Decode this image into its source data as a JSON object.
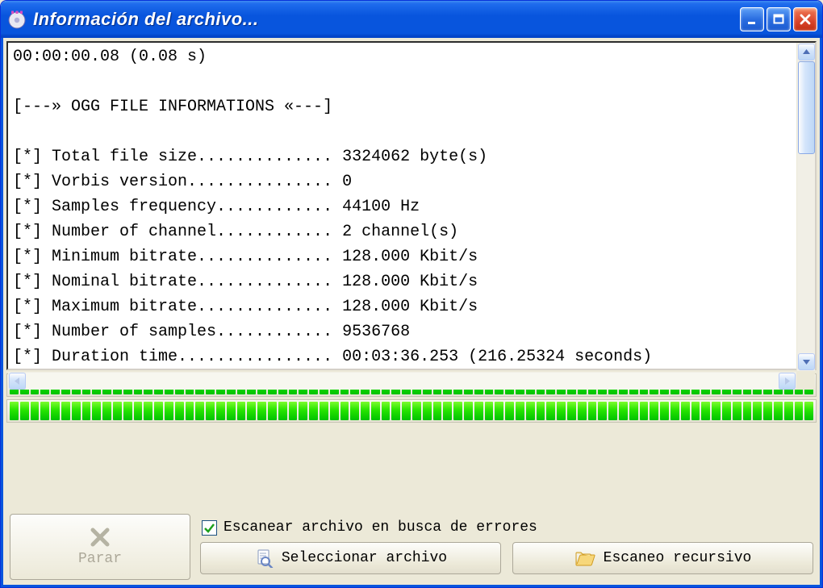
{
  "window": {
    "title": "Información del archivo..."
  },
  "output": {
    "line0": "00:00:00.08 (0.08 s)",
    "blank": "",
    "header": "[---» OGG FILE INFORMATIONS «---]",
    "rows": {
      "r0": "[*] Total file size.............. 3324062 byte(s)",
      "r1": "[*] Vorbis version............... 0",
      "r2": "[*] Samples frequency............ 44100 Hz",
      "r3": "[*] Number of channel............ 2 channel(s)",
      "r4": "[*] Minimum bitrate.............. 128.000 Kbit/s",
      "r5": "[*] Nominal bitrate.............. 128.000 Kbit/s",
      "r6": "[*] Maximum bitrate.............. 128.000 Kbit/s",
      "r7": "[*] Number of samples............ 9536768",
      "r8": "[*] Duration time................ 00:03:36.253 (216.25324 seconds)"
    }
  },
  "controls": {
    "stop": "Parar",
    "scan_errors": "Escanear archivo en busca de errores",
    "select_file": "Seleccionar archivo",
    "recursive_scan": "Escaneo recursivo"
  },
  "colors": {
    "titlebar": "#0855dd",
    "accent": "#00c200",
    "checkmark": "#1ca01c"
  }
}
